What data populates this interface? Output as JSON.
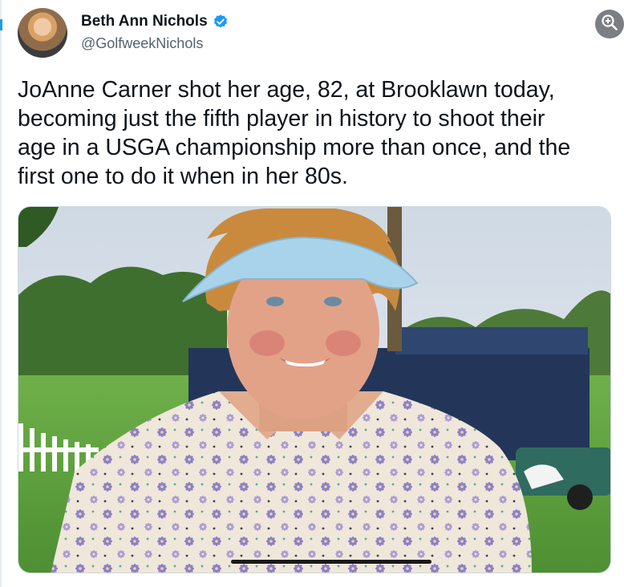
{
  "author": {
    "display_name": "Beth Ann Nichols",
    "handle": "@GolfweekNichols",
    "verified": true
  },
  "tweet": {
    "lines": [
      "JoAnne Carner shot her age, 82, at Brooklawn today,",
      "becoming just the fifth player in history to shoot their",
      "age in a USGA championship more than once, and the",
      "first one to do it when in her 80s."
    ]
  },
  "media": {
    "type": "photo"
  },
  "icons": {
    "verified": "verified-badge-icon",
    "zoom": "zoom-in-icon"
  },
  "colors": {
    "verified_blue": "#1d9bf0",
    "handle_gray": "#536471",
    "text": "#0f1419"
  }
}
